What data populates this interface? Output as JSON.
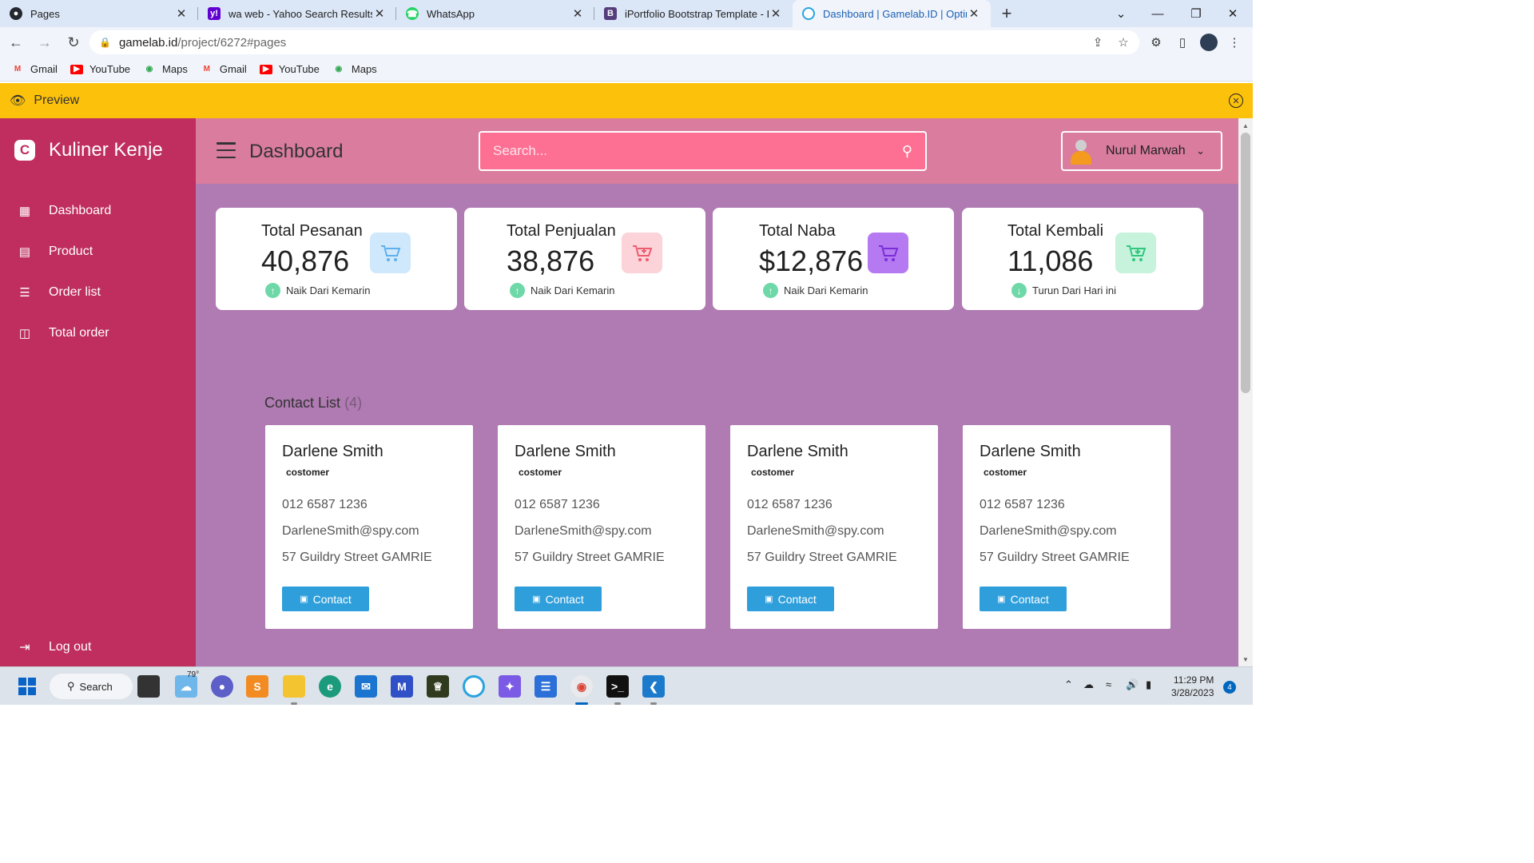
{
  "browser": {
    "tabs": [
      {
        "title": "Pages",
        "icon": "github-icon",
        "color": "#24292f"
      },
      {
        "title": "wa web - Yahoo Search Results",
        "icon": "yahoo-icon",
        "color": "#6001d2"
      },
      {
        "title": "WhatsApp",
        "icon": "whatsapp-icon",
        "color": "#25d366"
      },
      {
        "title": "iPortfolio Bootstrap Template - In",
        "icon": "bootstrap-icon",
        "color": "#563d7c"
      },
      {
        "title": "Dashboard | Gamelab.ID | Optimi",
        "icon": "gamelab-icon",
        "color": "#2aa3e0"
      }
    ],
    "url_host": "gamelab.id",
    "url_path": "/project/6272#pages",
    "bookmarks": [
      {
        "label": "Gmail",
        "icon": "gmail-icon"
      },
      {
        "label": "YouTube",
        "icon": "youtube-icon"
      },
      {
        "label": "Maps",
        "icon": "maps-icon"
      },
      {
        "label": "Gmail",
        "icon": "gmail-icon"
      },
      {
        "label": "YouTube",
        "icon": "youtube-icon"
      },
      {
        "label": "Maps",
        "icon": "maps-icon"
      }
    ]
  },
  "preview": {
    "label": "Preview"
  },
  "app": {
    "brand": "Kuliner Kenje",
    "nav": [
      {
        "label": "Dashboard",
        "icon": "grid-icon"
      },
      {
        "label": "Product",
        "icon": "archive-icon"
      },
      {
        "label": "Order list",
        "icon": "list-icon"
      },
      {
        "label": "Total order",
        "icon": "book-icon"
      }
    ],
    "logout": "Log out",
    "page_title": "Dashboard",
    "search_placeholder": "Search...",
    "user_name": "Nurul Marwah",
    "stats": [
      {
        "title": "Total Pesanan",
        "value": "40,876",
        "trend": "Naik Dari Kemarin",
        "direction": "up",
        "icon_bg": "#cfe8fb",
        "icon_color": "#5fb0ec"
      },
      {
        "title": "Total Penjualan",
        "value": "38,876",
        "trend": "Naik Dari Kemarin",
        "direction": "up",
        "icon_bg": "#fbd3d8",
        "icon_color": "#ef5b6e"
      },
      {
        "title": "Total Naba",
        "value": "$12,876",
        "trend": "Naik Dari Kemarin",
        "direction": "up",
        "icon_bg": "#b57af2",
        "icon_color": "#7a2fd6"
      },
      {
        "title": "Total Kembali",
        "value": "11,086",
        "trend": "Turun Dari Hari ini",
        "direction": "down",
        "icon_bg": "#c7f3dd",
        "icon_color": "#32c77e"
      }
    ],
    "contacts_heading": "Contact List",
    "contacts_count": "(4)",
    "contacts": [
      {
        "name": "Darlene Smith",
        "role": "costomer",
        "phone": "012 6587 1236",
        "email": "DarleneSmith@spy.com",
        "address": "57 Guildry Street GAMRIE",
        "button": "Contact"
      },
      {
        "name": "Darlene Smith",
        "role": "costomer",
        "phone": "012 6587 1236",
        "email": "DarleneSmith@spy.com",
        "address": "57 Guildry Street GAMRIE",
        "button": "Contact"
      },
      {
        "name": "Darlene Smith",
        "role": "costomer",
        "phone": "012 6587 1236",
        "email": "DarleneSmith@spy.com",
        "address": "57 Guildry Street GAMRIE",
        "button": "Contact"
      },
      {
        "name": "Darlene Smith",
        "role": "costomer",
        "phone": "012 6587 1236",
        "email": "DarleneSmith@spy.com",
        "address": "57 Guildry Street GAMRIE",
        "button": "Contact"
      }
    ],
    "colors": {
      "sidebar": "#bf2e5e",
      "topbar": "#d97c9d",
      "content": "#b07ab2",
      "search": "#fd6f93",
      "button": "#2f9fdc"
    }
  },
  "taskbar": {
    "search_label": "Search",
    "weather": "79°",
    "time": "11:29 PM",
    "date": "3/28/2023",
    "notifications": "4"
  }
}
